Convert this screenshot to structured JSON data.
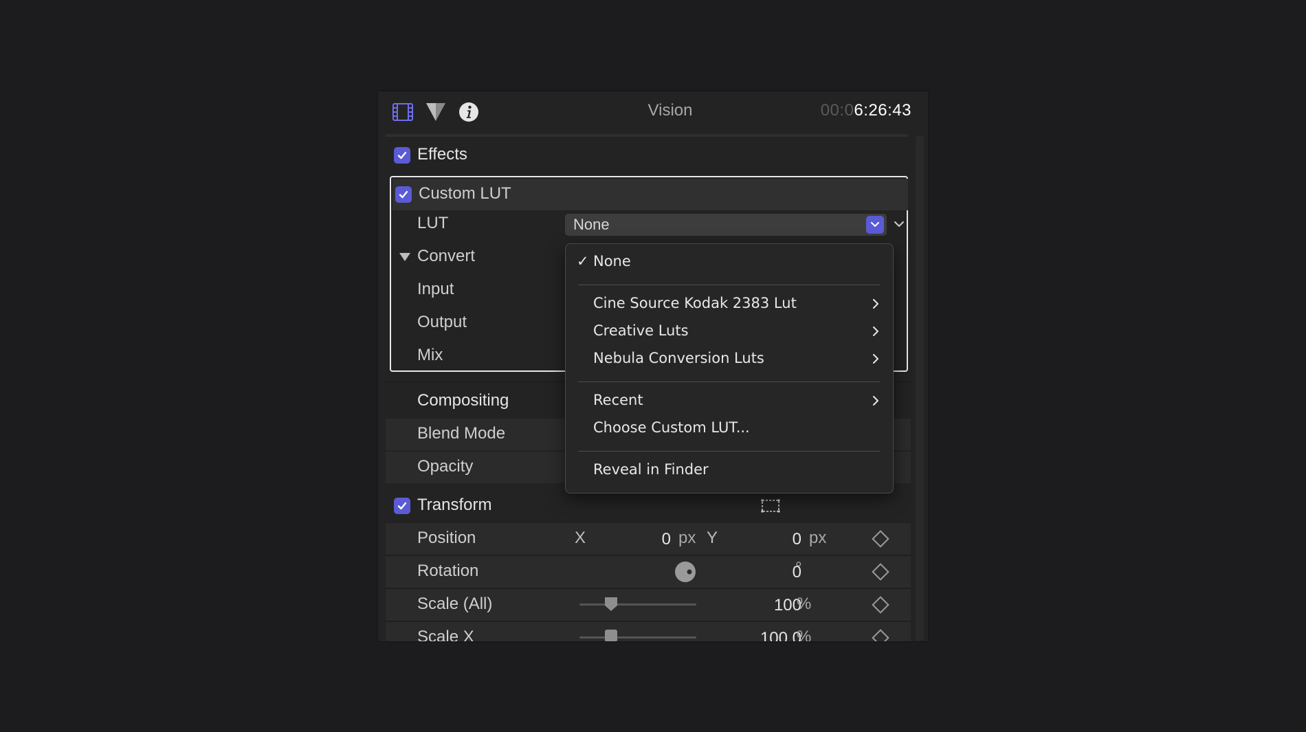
{
  "header": {
    "title": "Vision",
    "timecode_dim": "00:0",
    "timecode": "6:26:43",
    "tabs": [
      "video-inspector-icon",
      "color-inspector-icon",
      "info-inspector-icon"
    ]
  },
  "effects": {
    "label": "Effects",
    "checked": true
  },
  "custom_lut": {
    "label": "Custom LUT",
    "checked": true,
    "lut_label": "LUT",
    "lut_value": "None",
    "convert_label": "Convert",
    "rows": [
      "Input",
      "Output",
      "Mix"
    ]
  },
  "compositing": {
    "label": "Compositing",
    "blend_mode_label": "Blend Mode",
    "opacity_label": "Opacity"
  },
  "transform": {
    "label": "Transform",
    "checked": true,
    "position": {
      "label": "Position",
      "x_label": "X",
      "x_value": "0",
      "x_unit": "px",
      "y_label": "Y",
      "y_value": "0",
      "y_unit": "px"
    },
    "rotation": {
      "label": "Rotation",
      "value": "0",
      "unit": "°"
    },
    "scale_all": {
      "label": "Scale (All)",
      "value": "100",
      "unit": "%"
    },
    "scale_x": {
      "label": "Scale X",
      "value": "100.0",
      "unit": "%"
    }
  },
  "lut_menu": {
    "selected": "None",
    "items": [
      {
        "label": "Cine Source Kodak 2383 Lut",
        "submenu": true
      },
      {
        "label": "Creative Luts",
        "submenu": true
      },
      {
        "label": "Nebula Conversion Luts",
        "submenu": true
      },
      {
        "label": "Recent",
        "submenu": true
      },
      {
        "label": "Choose Custom LUT...",
        "submenu": false
      },
      {
        "label": "Reveal in Finder",
        "submenu": false
      }
    ]
  },
  "colors": {
    "accent": "#5b5bd6",
    "background": "#1c1c1e",
    "panel": "#232323"
  }
}
